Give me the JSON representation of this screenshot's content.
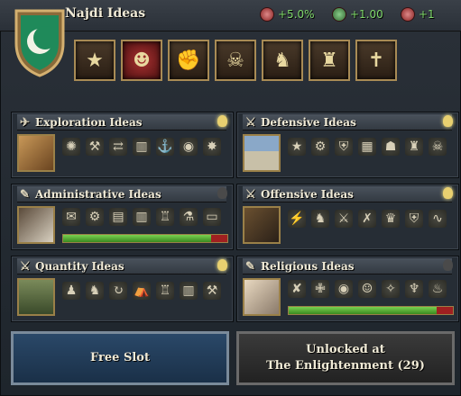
{
  "header": {
    "title": "Najdi Ideas",
    "stats": [
      {
        "value": "+5.0%",
        "icon": "stability-icon"
      },
      {
        "value": "+1.00",
        "icon": "trade-icon"
      },
      {
        "value": "+1",
        "icon": "diplomat-icon"
      }
    ]
  },
  "panels": [
    {
      "name": "exploration",
      "title": "Exploration Ideas",
      "bulb": "on",
      "icons": [
        "compass",
        "telescope",
        "ship",
        "coins",
        "anchor",
        "globe",
        "sun"
      ]
    },
    {
      "name": "defensive",
      "title": "Defensive Ideas",
      "bulb": "on",
      "icons": [
        "fort",
        "cannon",
        "shield",
        "wall",
        "helmet",
        "castle",
        "skull"
      ]
    },
    {
      "name": "administrative",
      "title": "Administrative Ideas",
      "bulb": "off",
      "icons": [
        "scroll",
        "gear",
        "ledger",
        "coins",
        "tower",
        "flask",
        "map"
      ],
      "progress": 0.9
    },
    {
      "name": "offensive",
      "title": "Offensive Ideas",
      "bulb": "on",
      "icons": [
        "bolt",
        "horse",
        "sword",
        "arrows",
        "crown",
        "shield",
        "rope"
      ]
    },
    {
      "name": "quantity",
      "title": "Quantity Ideas",
      "bulb": "on",
      "icons": [
        "soldier",
        "cavalry",
        "cycle",
        "camp",
        "tower",
        "gold",
        "hammer"
      ]
    },
    {
      "name": "religious",
      "title": "Religious Ideas",
      "bulb": "off",
      "icons": [
        "book",
        "cross",
        "orb",
        "face",
        "dove",
        "chalice",
        "torch"
      ],
      "progress": 0.9
    }
  ],
  "slots": {
    "free": "Free Slot",
    "locked_line1": "Unlocked at",
    "locked_line2": "The Enlightenment (29)"
  },
  "colors": {
    "accent": "#a88b55",
    "positive": "#7fd86a"
  }
}
